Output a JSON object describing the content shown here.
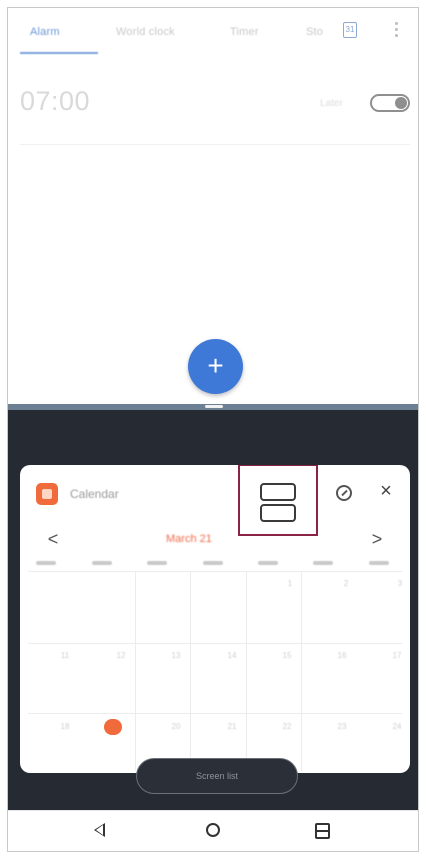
{
  "top_app": {
    "tabs": [
      {
        "label": "Alarm"
      },
      {
        "label": "World clock"
      },
      {
        "label": "Timer"
      },
      {
        "label": "Sto"
      }
    ],
    "tab_icon_text": "31",
    "alarm": {
      "time": "07:00",
      "label": "Later",
      "enabled": false
    },
    "fab_label": "+"
  },
  "bottom_app": {
    "title": "Calendar",
    "month": "March 21",
    "weekdays": [
      "SUN",
      "MON",
      "TUE",
      "WED",
      "THU",
      "FRI",
      "SAT"
    ],
    "days_row1": [
      "",
      "",
      "",
      "",
      "1",
      "2",
      "3"
    ],
    "days_row2": [
      "11",
      "12",
      "13",
      "14",
      "15",
      "16",
      "17"
    ],
    "days_row3": [
      "18",
      "19",
      "20",
      "21",
      "22",
      "23",
      "24"
    ],
    "nav_prev": "<",
    "nav_next": ">",
    "close_label": "×",
    "screen_button_label": "Screen list"
  },
  "colors": {
    "accent_blue": "#3f79d8",
    "highlight_frame": "#8a2446",
    "calendar_orange": "#f06a3c"
  }
}
